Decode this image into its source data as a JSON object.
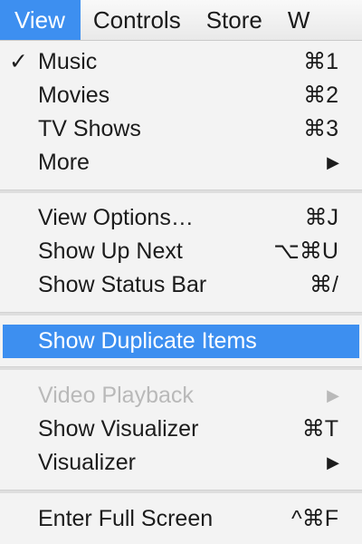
{
  "menubar": {
    "items": [
      {
        "label": "View",
        "active": true
      },
      {
        "label": "Controls",
        "active": false
      },
      {
        "label": "Store",
        "active": false
      },
      {
        "label": "W",
        "active": false
      }
    ]
  },
  "menu": {
    "music": {
      "check": "✓",
      "label": "Music",
      "shortcut": "⌘1"
    },
    "movies": {
      "label": "Movies",
      "shortcut": "⌘2"
    },
    "tv_shows": {
      "label": "TV Shows",
      "shortcut": "⌘3"
    },
    "more": {
      "label": "More",
      "submenu_arrow": "▶"
    },
    "view_options": {
      "label": "View Options…",
      "shortcut": "⌘J"
    },
    "show_up_next": {
      "label": "Show Up Next",
      "shortcut": "⌥⌘U"
    },
    "show_status_bar": {
      "label": "Show Status Bar",
      "shortcut": "⌘/"
    },
    "show_duplicate_items": {
      "label": "Show Duplicate Items"
    },
    "video_playback": {
      "label": "Video Playback",
      "submenu_arrow": "▶",
      "disabled": true
    },
    "show_visualizer": {
      "label": "Show Visualizer",
      "shortcut": "⌘T"
    },
    "visualizer": {
      "label": "Visualizer",
      "submenu_arrow": "▶"
    },
    "enter_full_screen": {
      "label": "Enter Full Screen",
      "shortcut": "^⌘F"
    }
  },
  "colors": {
    "highlight": "#3d8ff0",
    "disabled_text": "#b9b9b9",
    "menu_background": "#f3f3f3"
  }
}
